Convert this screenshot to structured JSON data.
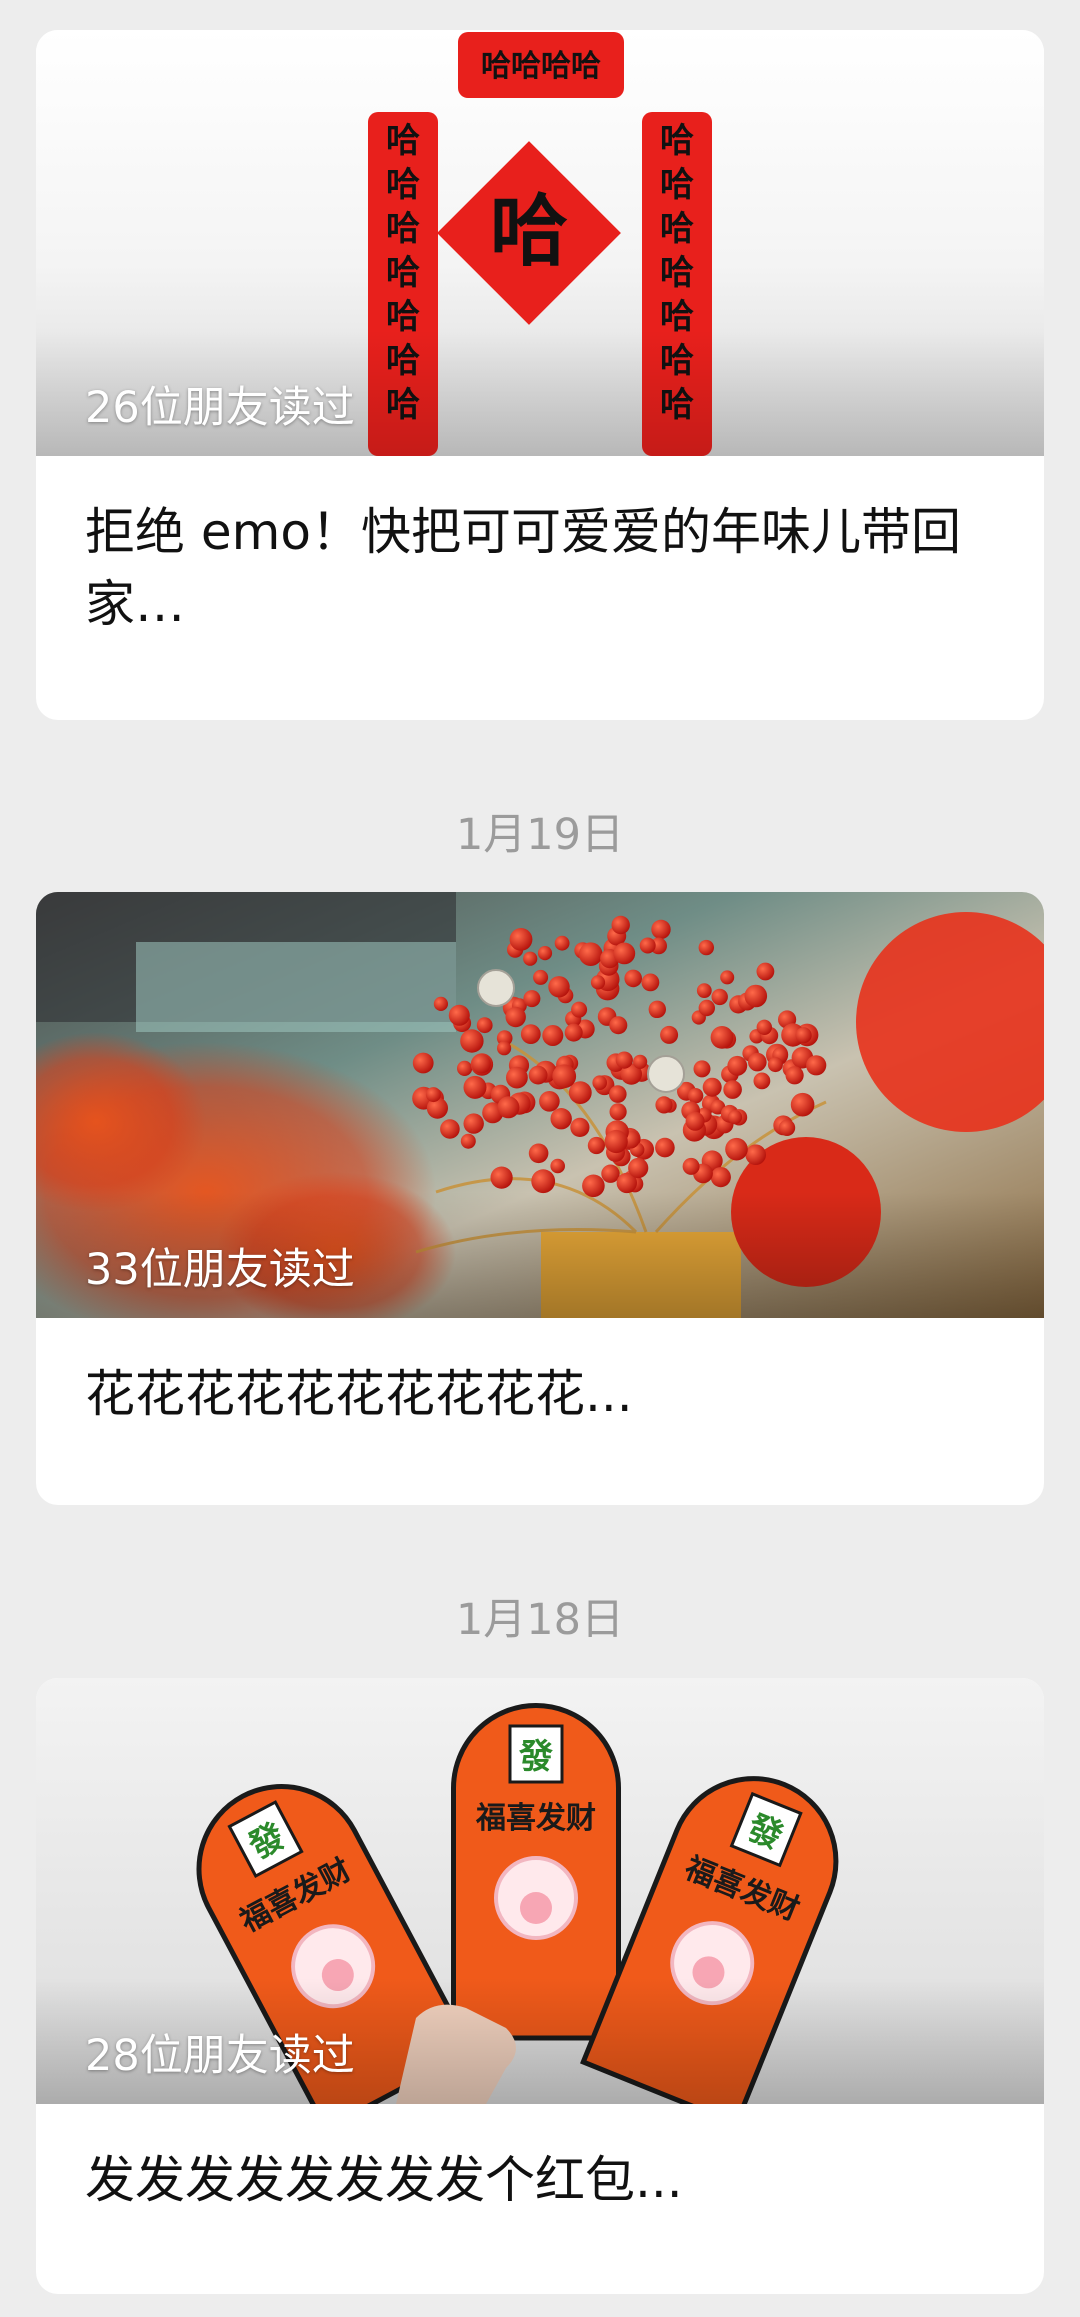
{
  "colors": {
    "background": "#ededed",
    "card": "#ffffff",
    "date_text": "#9b9b9b",
    "title_text": "#111111",
    "festive_red": "#e8201c",
    "envelope_orange": "#f05a1a"
  },
  "articles": [
    {
      "read_count": "26位朋友读过",
      "title": "拒绝 emo！快把可可爱爱的年味儿带回家…",
      "image_icon": "couplet-image",
      "image_text": {
        "banner": "哈哈哈哈",
        "center": "哈",
        "couplet": "哈"
      }
    },
    {
      "date": "1月19日",
      "read_count": "33位朋友读过",
      "title": "花花花花花花花花花花...",
      "image_icon": "flower-bouquet-image"
    },
    {
      "date": "1月18日",
      "read_count": "28位朋友读过",
      "title": "发发发发发发发发个红包...",
      "image_icon": "red-envelope-image",
      "image_text": {
        "tile": "發",
        "envelope": "福喜发财"
      }
    }
  ]
}
